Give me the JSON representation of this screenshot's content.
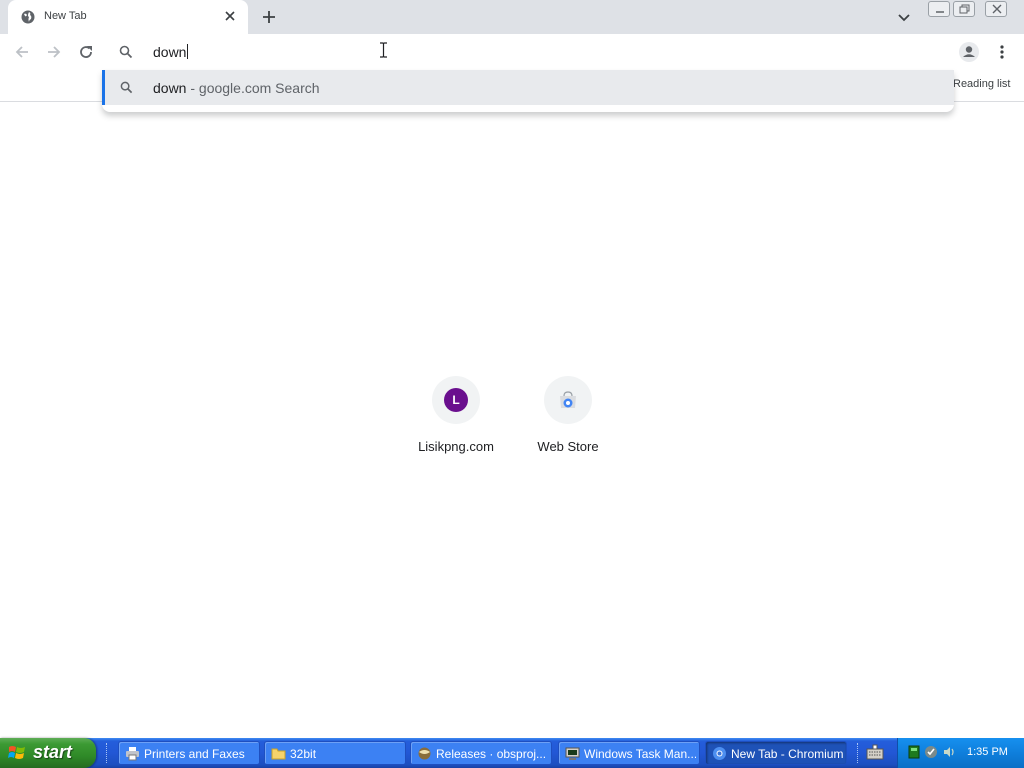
{
  "browser": {
    "tab": {
      "title": "New Tab"
    },
    "omnibox": {
      "query": "down"
    },
    "suggestion": {
      "query": "down",
      "description": " - google.com Search"
    },
    "bookmarks_bar": {
      "reading_list_label": "Reading list"
    },
    "accent_color": "#1a73e8"
  },
  "newtab": {
    "shortcuts": [
      {
        "letter": "L",
        "label": "Lisikpng.com",
        "icon": "letter-avatar",
        "color": "#6a0f8e"
      },
      {
        "label": "Web Store",
        "icon": "web-store-icon"
      }
    ]
  },
  "taskbar": {
    "start_label": "start",
    "tasks": [
      {
        "label": "Printers and Faxes",
        "icon": "printer-icon"
      },
      {
        "label": "32bit",
        "icon": "folder-icon"
      },
      {
        "label": "Releases · obsproj...",
        "icon": "browser-icon"
      },
      {
        "label": "Windows Task Man...",
        "icon": "task-manager-icon"
      },
      {
        "label": "New Tab - Chromium",
        "icon": "chromium-icon",
        "active": true
      }
    ],
    "clock": "1:35 PM"
  }
}
